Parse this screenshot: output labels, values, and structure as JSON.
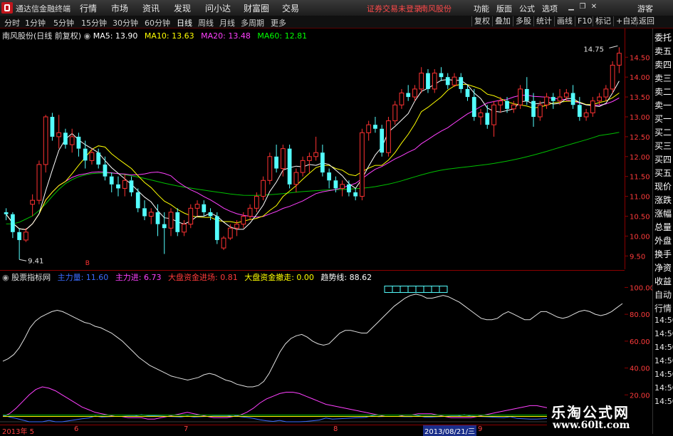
{
  "window": {
    "title": "通达信金融终端",
    "menu": [
      "行情",
      "市场",
      "资讯",
      "发现",
      "问小达",
      "财富圈",
      "交易"
    ],
    "alert": "证券交易未登录",
    "stock_name_top": "南风股份",
    "right_menu": [
      "功能",
      "版面",
      "公式",
      "选项"
    ],
    "guest": "游客"
  },
  "toolbar": {
    "periods": [
      "分时",
      "1分钟",
      "5分钟",
      "15分钟",
      "30分钟",
      "60分钟",
      "日线",
      "周线",
      "月线",
      "多周期",
      "更多"
    ],
    "active_period": "日线",
    "right_buttons": [
      "复权",
      "叠加",
      "多股",
      "统计",
      "画线",
      "F10",
      "标记",
      "+自选",
      "返回"
    ]
  },
  "main_chart": {
    "header": "南风股份(日线 前复权)",
    "ma_legend": [
      {
        "label": "MA5: 13.90",
        "color": "#ffffff"
      },
      {
        "label": "MA10: 13.63",
        "color": "#ffff00"
      },
      {
        "label": "MA20: 13.48",
        "color": "#ff40ff"
      },
      {
        "label": "MA60: 12.81",
        "color": "#00ff00"
      }
    ],
    "price_ticks": [
      "14.50",
      "14.00",
      "13.50",
      "13.00",
      "12.50",
      "12.00",
      "11.50",
      "11.00",
      "10.50",
      "10.00",
      "9.50"
    ],
    "high_marker": "14.75",
    "low_marker": "9.41",
    "b_marker": "B",
    "colors": {
      "up": "#ff3232",
      "down": "#54ffff",
      "ma5": "#ffffff",
      "ma10": "#ffff00",
      "ma20": "#ff40ff",
      "ma60": "#00c000"
    }
  },
  "indicator": {
    "name": "股票指标网",
    "legend": [
      {
        "label": "主力量: 11.60",
        "color": "#3a6bff"
      },
      {
        "label": "主力进: 6.73",
        "color": "#ff40ff"
      },
      {
        "label": "大盘资金进场: 0.81",
        "color": "#ff3b3b"
      },
      {
        "label": "大盘资金撤走: 0.00",
        "color": "#ffff00"
      },
      {
        "label": "趋势线: 88.62",
        "color": "#ffffff"
      }
    ],
    "ticks": [
      "100.00",
      "80.00",
      "60.00",
      "40.00",
      "20.00"
    ]
  },
  "sidebar": {
    "items": [
      "委托",
      "卖五",
      "卖四",
      "卖三",
      "卖二",
      "卖一",
      "买一",
      "买二",
      "买三",
      "买四",
      "买五",
      "现价",
      "涨跌",
      "涨幅",
      "总量",
      "外盘",
      "换手",
      "净资",
      "收益",
      "自动",
      "行情",
      "14:50",
      "14:50",
      "14:50",
      "14:50",
      "14:50",
      "14:50",
      "14:50"
    ]
  },
  "date_axis": {
    "labels": [
      "2013年 5",
      "6",
      "7",
      "8",
      "9"
    ],
    "cursor_date": "2013/08/21/三"
  },
  "watermark": {
    "line1": "乐淘公式网",
    "line2": "www.60lt.com"
  },
  "chart_data": {
    "type": "candlestick",
    "title": "南风股份(日线 前复权)",
    "ylim": [
      9.2,
      14.9
    ],
    "candles": [
      [
        10.6,
        10.7,
        10.4,
        10.55
      ],
      [
        10.55,
        10.6,
        9.95,
        10.1
      ],
      [
        10.1,
        10.2,
        9.41,
        9.9
      ],
      [
        9.9,
        10.2,
        9.85,
        10.1
      ],
      [
        10.8,
        11.05,
        10.5,
        10.9
      ],
      [
        10.9,
        11.9,
        10.8,
        11.8
      ],
      [
        11.8,
        13.05,
        11.6,
        13.0
      ],
      [
        13.0,
        13.1,
        12.4,
        12.5
      ],
      [
        12.5,
        13.05,
        12.2,
        12.6
      ],
      [
        12.6,
        12.7,
        12.2,
        12.3
      ],
      [
        12.3,
        12.7,
        12.1,
        12.5
      ],
      [
        12.5,
        12.6,
        12.0,
        12.2
      ],
      [
        12.2,
        12.4,
        11.7,
        11.9
      ],
      [
        11.9,
        12.2,
        11.8,
        12.1
      ],
      [
        12.1,
        12.2,
        11.7,
        11.8
      ],
      [
        11.8,
        12.0,
        11.4,
        11.5
      ],
      [
        11.5,
        11.6,
        11.1,
        11.3
      ],
      [
        11.3,
        11.5,
        11.0,
        11.2
      ],
      [
        11.2,
        11.55,
        11.0,
        11.4
      ],
      [
        11.4,
        11.5,
        11.0,
        11.1
      ],
      [
        11.1,
        11.2,
        10.6,
        10.7
      ],
      [
        10.7,
        10.9,
        10.4,
        10.5
      ],
      [
        10.5,
        10.7,
        10.3,
        10.6
      ],
      [
        10.6,
        10.8,
        10.0,
        10.3
      ],
      [
        10.3,
        10.6,
        9.55,
        10.2
      ],
      [
        10.2,
        10.7,
        10.0,
        10.6
      ],
      [
        10.6,
        10.7,
        10.0,
        10.1
      ],
      [
        10.1,
        10.4,
        10.0,
        10.3
      ],
      [
        10.3,
        10.8,
        10.2,
        10.7
      ],
      [
        10.7,
        10.9,
        10.5,
        10.8
      ],
      [
        10.8,
        10.9,
        10.5,
        10.6
      ],
      [
        10.6,
        10.7,
        10.4,
        10.5
      ],
      [
        10.5,
        10.6,
        9.8,
        9.9
      ],
      [
        9.7,
        10.0,
        9.65,
        9.95
      ],
      [
        9.95,
        10.3,
        9.9,
        10.2
      ],
      [
        10.2,
        10.4,
        10.0,
        10.3
      ],
      [
        10.3,
        10.6,
        10.2,
        10.5
      ],
      [
        10.5,
        10.8,
        10.4,
        10.7
      ],
      [
        10.7,
        11.1,
        10.6,
        11.0
      ],
      [
        11.0,
        11.5,
        10.9,
        11.4
      ],
      [
        11.4,
        12.1,
        11.3,
        12.0
      ],
      [
        12.0,
        12.3,
        11.6,
        11.7
      ],
      [
        11.7,
        12.3,
        11.5,
        12.2
      ],
      [
        12.2,
        12.3,
        11.2,
        11.3
      ],
      [
        11.3,
        11.7,
        11.1,
        11.6
      ],
      [
        11.6,
        12.0,
        11.5,
        11.9
      ],
      [
        11.9,
        12.1,
        11.6,
        12.0
      ],
      [
        12.0,
        12.5,
        11.9,
        12.1
      ],
      [
        12.1,
        12.3,
        11.5,
        11.6
      ],
      [
        11.6,
        11.7,
        11.2,
        11.4
      ],
      [
        11.4,
        11.5,
        11.1,
        11.2
      ],
      [
        11.2,
        11.4,
        11.0,
        11.3
      ],
      [
        11.3,
        11.4,
        11.0,
        11.1
      ],
      [
        11.1,
        11.2,
        10.9,
        11.0
      ],
      [
        11.0,
        12.7,
        10.9,
        12.6
      ],
      [
        12.6,
        12.9,
        12.4,
        12.8
      ],
      [
        12.8,
        13.0,
        12.6,
        12.7
      ],
      [
        12.7,
        12.8,
        12.0,
        12.1
      ],
      [
        12.1,
        13.0,
        12.0,
        12.9
      ],
      [
        12.9,
        13.4,
        12.8,
        13.3
      ],
      [
        13.3,
        13.7,
        13.2,
        13.6
      ],
      [
        13.6,
        13.8,
        13.4,
        13.5
      ],
      [
        13.5,
        13.8,
        13.4,
        13.7
      ],
      [
        13.7,
        14.25,
        13.6,
        14.1
      ],
      [
        14.1,
        14.2,
        13.6,
        13.7
      ],
      [
        13.7,
        14.2,
        13.6,
        14.1
      ],
      [
        14.1,
        14.25,
        13.9,
        14.0
      ],
      [
        14.0,
        14.1,
        13.7,
        13.8
      ],
      [
        13.8,
        14.1,
        13.75,
        14.0
      ],
      [
        14.0,
        14.1,
        13.6,
        13.7
      ],
      [
        13.7,
        13.8,
        13.4,
        13.5
      ],
      [
        13.5,
        13.7,
        12.9,
        13.0
      ],
      [
        13.0,
        13.2,
        12.8,
        13.1
      ],
      [
        13.1,
        13.3,
        12.7,
        12.8
      ],
      [
        12.8,
        13.4,
        12.5,
        13.3
      ],
      [
        13.3,
        13.5,
        13.1,
        13.4
      ],
      [
        13.4,
        13.5,
        13.1,
        13.2
      ],
      [
        13.2,
        13.4,
        13.1,
        13.3
      ],
      [
        13.3,
        13.8,
        13.2,
        13.7
      ],
      [
        13.7,
        14.0,
        13.3,
        13.4
      ],
      [
        13.4,
        13.6,
        12.75,
        13.0
      ],
      [
        13.0,
        13.4,
        12.9,
        13.3
      ],
      [
        13.3,
        13.6,
        13.2,
        13.5
      ],
      [
        13.5,
        13.6,
        13.2,
        13.4
      ],
      [
        13.4,
        13.7,
        13.3,
        13.5
      ],
      [
        13.5,
        13.7,
        13.4,
        13.6
      ],
      [
        13.6,
        13.8,
        13.2,
        13.3
      ],
      [
        13.3,
        13.5,
        12.9,
        13.0
      ],
      [
        13.0,
        13.2,
        12.9,
        13.1
      ],
      [
        13.1,
        13.5,
        13.0,
        13.4
      ],
      [
        13.4,
        13.6,
        13.3,
        13.5
      ],
      [
        13.5,
        13.8,
        13.4,
        13.7
      ],
      [
        13.7,
        14.4,
        13.6,
        14.3
      ],
      [
        14.3,
        14.75,
        14.1,
        14.6
      ]
    ],
    "trend_line": [
      45,
      47,
      50,
      55,
      62,
      70,
      75,
      78,
      80,
      82,
      83,
      82,
      80,
      78,
      76,
      74,
      73,
      71,
      70,
      68,
      66,
      63,
      60,
      56,
      52,
      48,
      45,
      42,
      40,
      38,
      36,
      34,
      33,
      32,
      31,
      32,
      33,
      35,
      36,
      35,
      33,
      31,
      30,
      28,
      27,
      26,
      26,
      27,
      30,
      36,
      44,
      52,
      58,
      62,
      64,
      65,
      63,
      60,
      58,
      57,
      58,
      62,
      66,
      68,
      68,
      67,
      66,
      66,
      70,
      74,
      78,
      82,
      86,
      89,
      92,
      94,
      95,
      94,
      92,
      92,
      93,
      94,
      93,
      91,
      89,
      86,
      83,
      80,
      77,
      76,
      76,
      77,
      80,
      82,
      80,
      78,
      76,
      76,
      79,
      82,
      82,
      80,
      78,
      77,
      78,
      80,
      82,
      83,
      82,
      80,
      79,
      80,
      82,
      85,
      88
    ],
    "main_force": [
      4,
      6,
      10,
      15,
      20,
      24,
      26,
      25,
      23,
      20,
      17,
      14,
      11,
      9,
      7,
      6,
      5,
      4,
      4,
      3,
      3,
      3,
      2,
      2,
      3,
      4,
      5,
      6,
      7,
      6,
      5,
      4,
      3,
      3,
      3,
      4,
      5,
      7,
      10,
      14,
      17,
      19,
      21,
      22,
      22,
      21,
      19,
      17,
      15,
      13,
      12,
      11,
      10,
      9,
      8,
      7,
      6,
      5,
      4,
      4,
      4,
      5,
      5,
      6,
      6,
      6,
      5,
      4,
      3,
      3,
      3,
      3,
      4,
      5,
      6,
      7,
      8,
      9,
      10,
      11,
      12,
      12,
      11,
      10,
      9,
      8,
      7,
      6,
      6,
      6,
      6,
      7,
      7,
      7,
      7
    ]
  }
}
